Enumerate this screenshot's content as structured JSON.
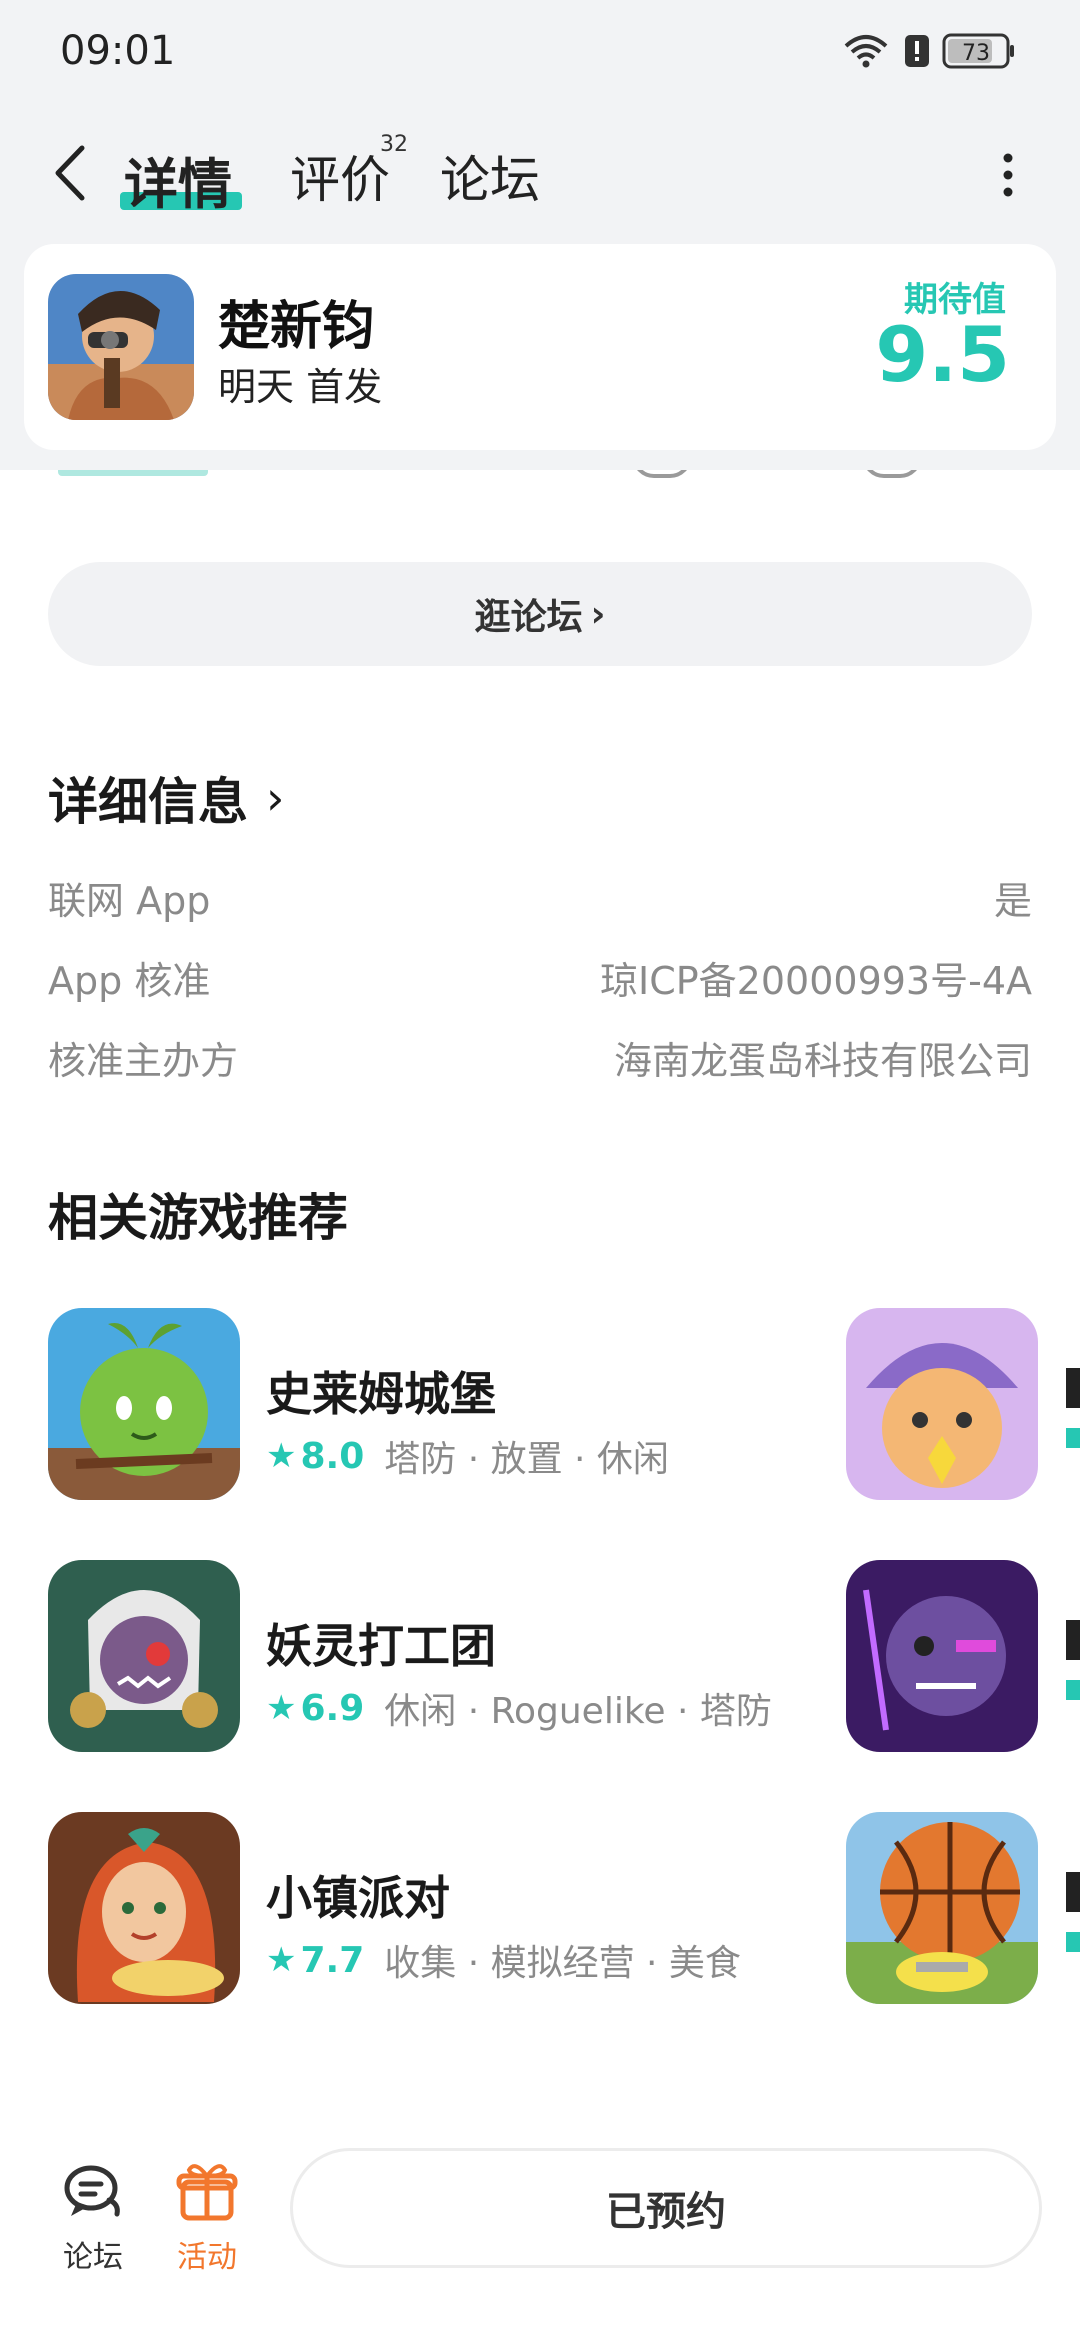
{
  "status_bar": {
    "time": "09:01",
    "battery": "73"
  },
  "header": {
    "tabs": [
      {
        "label": "详情",
        "active": true
      },
      {
        "label": "评价",
        "count": "32"
      },
      {
        "label": "论坛"
      }
    ]
  },
  "game": {
    "name": "楚新钧",
    "subtitle": "明天 首发",
    "expect_label": "期待值",
    "expect_value": "9.5"
  },
  "forum_button": {
    "label": "逛论坛",
    "chevron": "›"
  },
  "details": {
    "title": "详细信息",
    "chevron": "›",
    "rows": [
      {
        "key": "联网 App",
        "value": "是"
      },
      {
        "key": "App 核准",
        "value": "琼ICP备20000993号-4A"
      },
      {
        "key": "核准主办方",
        "value": "海南龙蛋岛科技有限公司"
      }
    ]
  },
  "recommend": {
    "title": "相关游戏推荐",
    "items": [
      {
        "name": "史莱姆城堡",
        "score": "8.0",
        "tags": "塔防 · 放置 · 休闲",
        "icon": "slime-castle-icon"
      },
      {
        "name": "妖灵打工团",
        "score": "6.9",
        "tags": "休闲 · Roguelike · 塔防",
        "icon": "spirit-work-icon"
      },
      {
        "name": "小镇派对",
        "score": "7.7",
        "tags": "收集 · 模拟经营 · 美食",
        "icon": "town-party-icon"
      }
    ]
  },
  "bottom_bar": {
    "forum_label": "论坛",
    "activity_label": "活动",
    "reserve_label": "已预约"
  },
  "colors": {
    "accent": "#26c7b3",
    "activity": "#f2772d"
  }
}
